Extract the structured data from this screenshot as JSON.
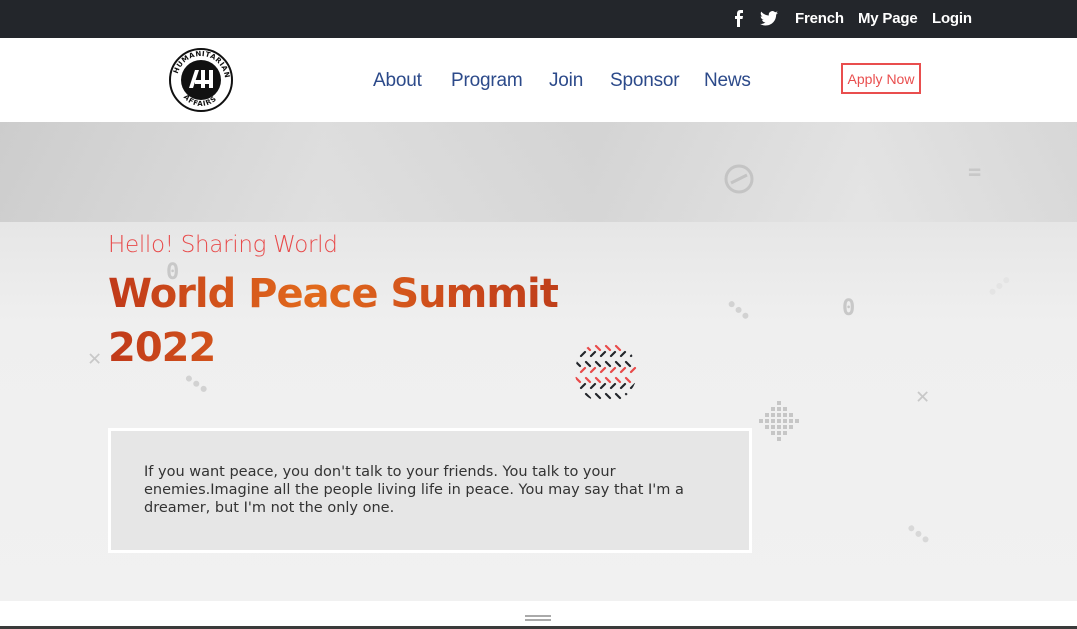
{
  "topbar": {
    "social": [
      "facebook-icon",
      "twitter-icon"
    ],
    "links": [
      "French",
      "My Page",
      "Login"
    ]
  },
  "header": {
    "logo_text": "HUMANITARIAN AFFAIRS",
    "logo_mark": "HA",
    "nav": [
      "About",
      "Program",
      "Join",
      "Sponsor",
      "News"
    ],
    "apply_label": "Apply Now"
  },
  "hero": {
    "kicker": "Hello! Sharing World",
    "title": "World Peace Summit 2022",
    "quote": "If you want peace, you don't talk to your friends. You talk to your enemies.Imagine all the people living life in peace. You may say that I'm a dreamer, but I'm not the only one."
  },
  "colors": {
    "accent": "#e84a4a",
    "nav": "#2c4a8a",
    "title_gradient": "#e26a1c",
    "topbar": "#23262b"
  }
}
